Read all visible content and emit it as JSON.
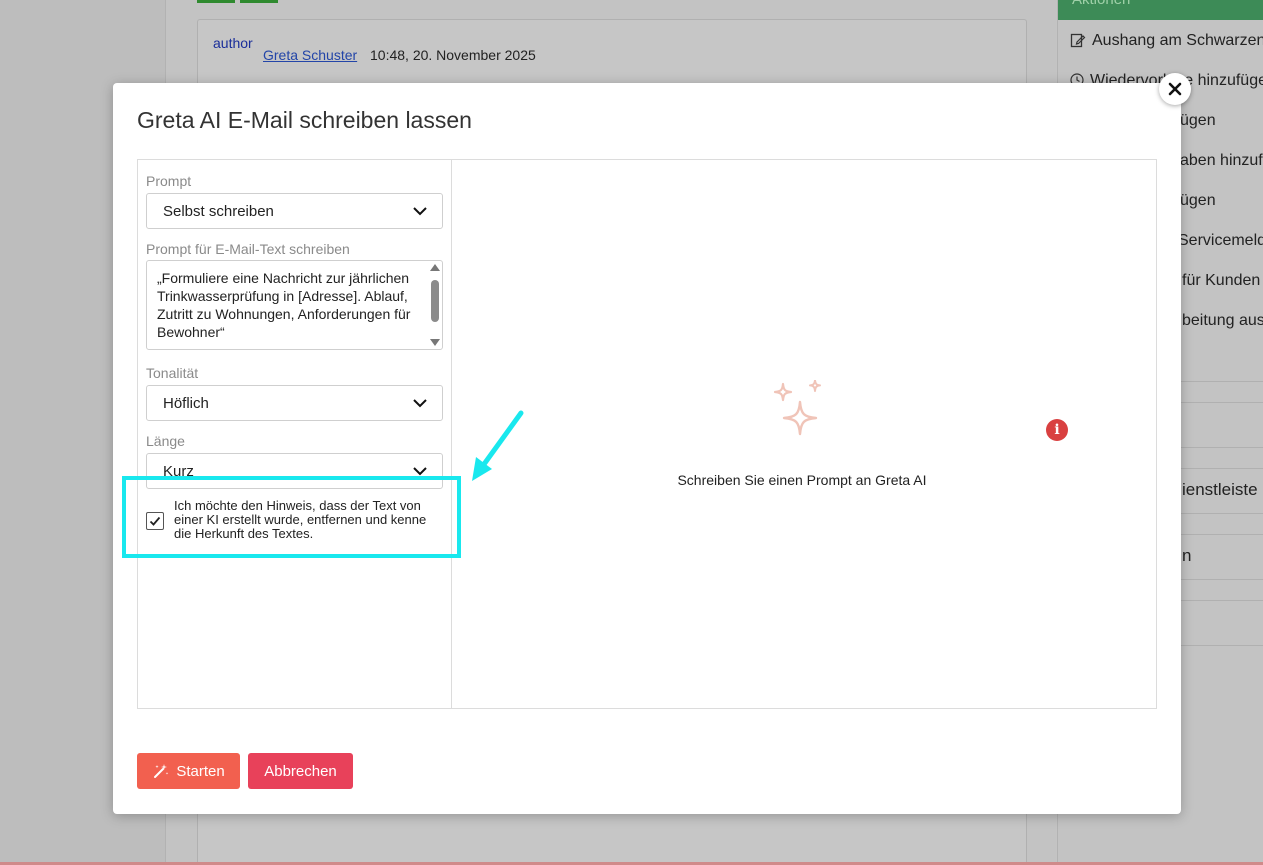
{
  "background": {
    "author_avatar_alt": "author",
    "author_name": "Greta Schuster",
    "timestamp": "10:48, 20. November 2025",
    "right_header": "Aktionen",
    "right_items": [
      "Aushang am Schwarzen",
      "Wiedervorlage hinzufüge",
      "ügen",
      "aben hinzuf",
      "ügen",
      "Servicemeld",
      "für Kunden",
      "beitung aus",
      "ienstleiste",
      "n"
    ]
  },
  "modal": {
    "title": "Greta AI E-Mail schreiben lassen",
    "prompt_label": "Prompt",
    "prompt_value": "Selbst schreiben",
    "email_text_label": "Prompt für E-Mail-Text schreiben",
    "email_text_value": "„Formuliere eine Nachricht zur jährlichen Trinkwasserprüfung in [Adresse]. Ablauf, Zutritt zu Wohnungen, Anforderungen für Bewohner“",
    "tone_label": "Tonalität",
    "tone_value": "Höflich",
    "length_label": "Länge",
    "length_value": "Kurz",
    "checkbox_label": "Ich möchte den Hinweis, dass der Text von einer KI erstellt wurde, entfernen und kenne die Herkunft des Textes.",
    "checkbox_checked": true,
    "empty_state_text": "Schreiben Sie einen Prompt an Greta AI",
    "start_label": "Starten",
    "cancel_label": "Abbrechen"
  },
  "colors": {
    "highlight": "#19e8ee",
    "start_button": "#f2604f",
    "cancel_button": "#e8415a",
    "sparkle": "#f0c4b8",
    "info": "#d94040"
  }
}
